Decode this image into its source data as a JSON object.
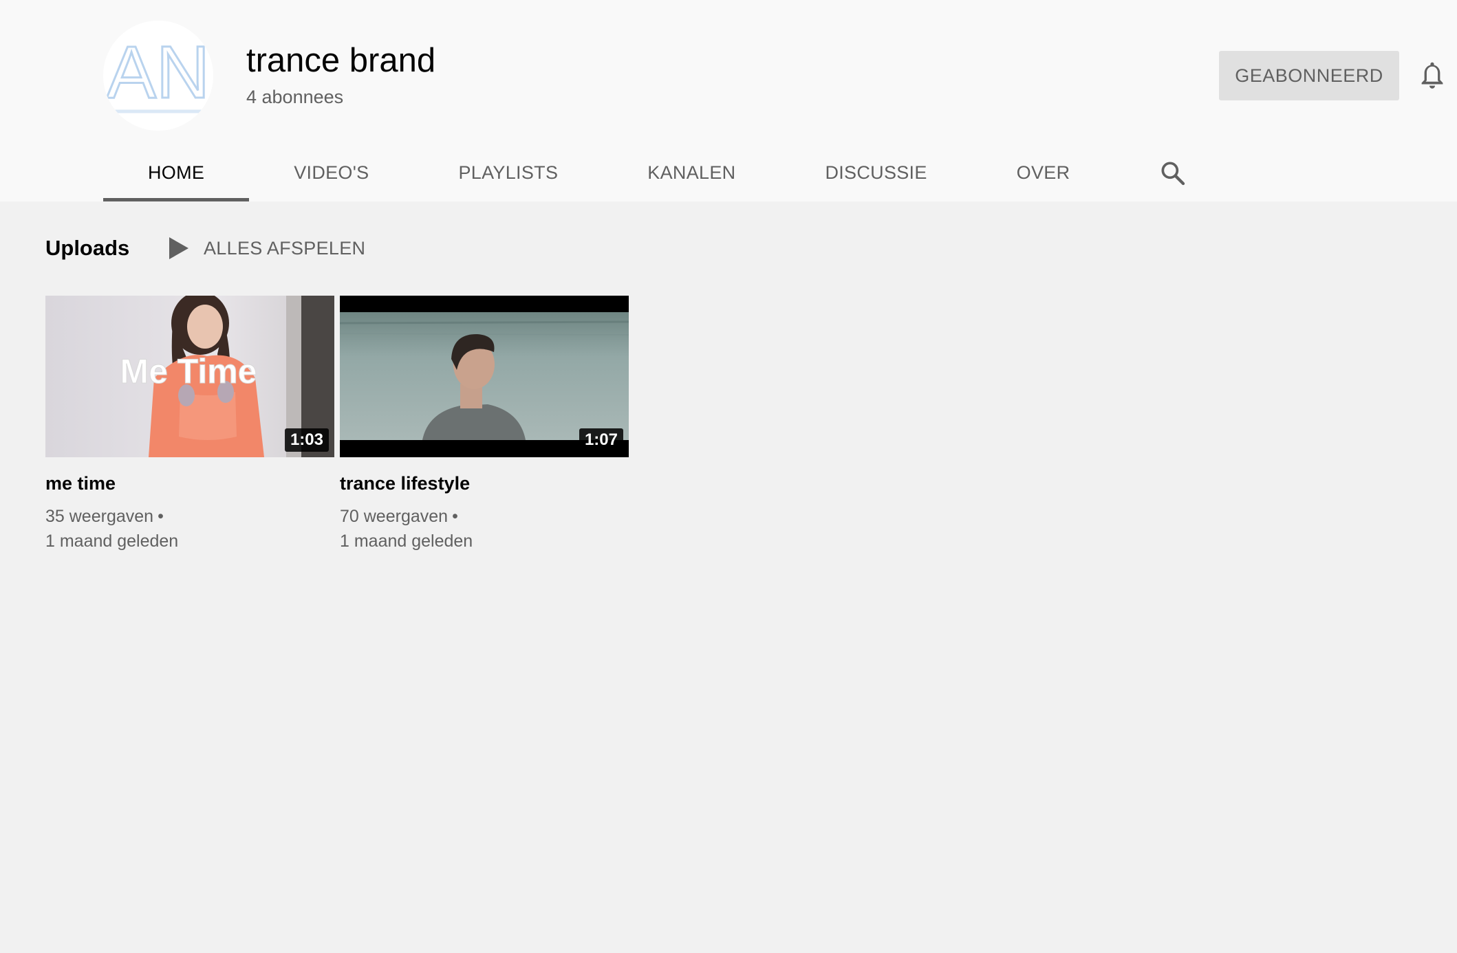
{
  "channel": {
    "name": "trance brand",
    "subscribers": "4 abonnees",
    "avatar_text": "AN",
    "subscribe_label": "GEABONNEERD",
    "bell_icon": "bell-icon"
  },
  "tabs": [
    {
      "label": "HOME",
      "active": true
    },
    {
      "label": "VIDEO'S",
      "active": false
    },
    {
      "label": "PLAYLISTS",
      "active": false
    },
    {
      "label": "KANALEN",
      "active": false
    },
    {
      "label": "DISCUSSIE",
      "active": false
    },
    {
      "label": "OVER",
      "active": false
    }
  ],
  "search_icon": "search-icon",
  "shelf": {
    "title": "Uploads",
    "play_all_label": "ALLES AFSPELEN",
    "play_icon": "play-icon"
  },
  "videos": [
    {
      "title": "me time",
      "thumbnail_text": "Me Time",
      "duration": "1:03",
      "views": "35 weergaven",
      "separator": "•",
      "age": "1 maand geleden"
    },
    {
      "title": "trance lifestyle",
      "thumbnail_text": "",
      "duration": "1:07",
      "views": "70 weergaven",
      "separator": "•",
      "age": "1 maand geleden"
    }
  ],
  "colors": {
    "page_bg": "#f1f1f1",
    "header_bg": "#f9f9f9",
    "text_primary": "#030303",
    "text_secondary": "#606060",
    "subscribed_button_bg": "#e0e0e0",
    "tab_indicator": "#606060"
  }
}
